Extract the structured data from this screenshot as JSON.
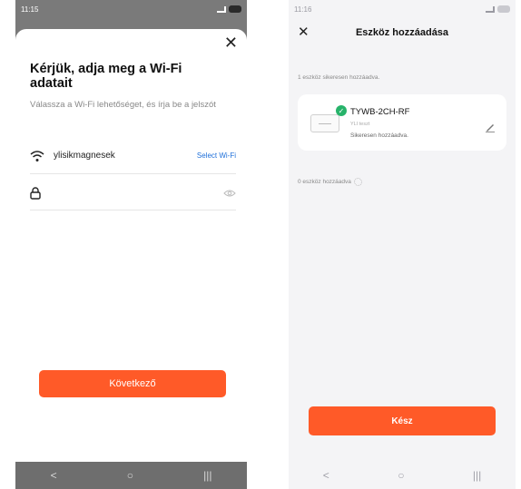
{
  "left": {
    "status_time": "11:15",
    "title": "Kérjük, adja meg a Wi-Fi adatait",
    "subtitle": "Válassza a Wi-Fi lehetőséget, és írja be a jelszót",
    "wifi_name": "ylisikmagnesek",
    "select_wifi_label": "Select Wi-Fi",
    "password_value": "",
    "next_label": "Következő"
  },
  "right": {
    "status_time": "11:16",
    "title": "Eszköz hozzáadása",
    "success_count_text": "1 eszköz sikeresen hozzáadva.",
    "device": {
      "name": "TYWB-2CH-RF",
      "room": "YLI teszt",
      "status": "Sikeresen hozzáadva."
    },
    "adding_count_text": "0 eszköz hozzáadva",
    "done_label": "Kész"
  },
  "nav": {
    "back": "<",
    "home": "○",
    "recents": "|||"
  },
  "colors": {
    "accent": "#ff5a28",
    "success": "#27b36a",
    "link": "#1e6fd9"
  }
}
